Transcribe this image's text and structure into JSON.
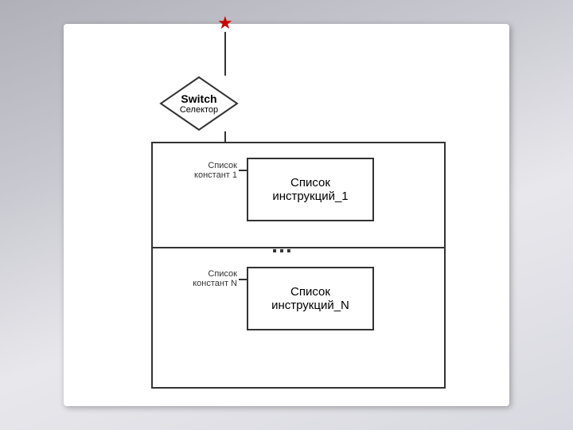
{
  "diagram": {
    "red_star": "★",
    "diamond": {
      "title": "Switch",
      "subtitle": "Селектор"
    },
    "labels": {
      "const1": "Список\nконстант 1",
      "constN": "Список\nконстант N",
      "const1_line1": "Список",
      "const1_line2": "констант 1",
      "constN_line1": "Список",
      "constN_line2": "констант N"
    },
    "boxes": {
      "box1_line1": "Список",
      "box1_line2": "инструкций_1",
      "boxN_line1": "Список",
      "boxN_line2": "инструкций_N"
    },
    "ellipsis": "…"
  }
}
